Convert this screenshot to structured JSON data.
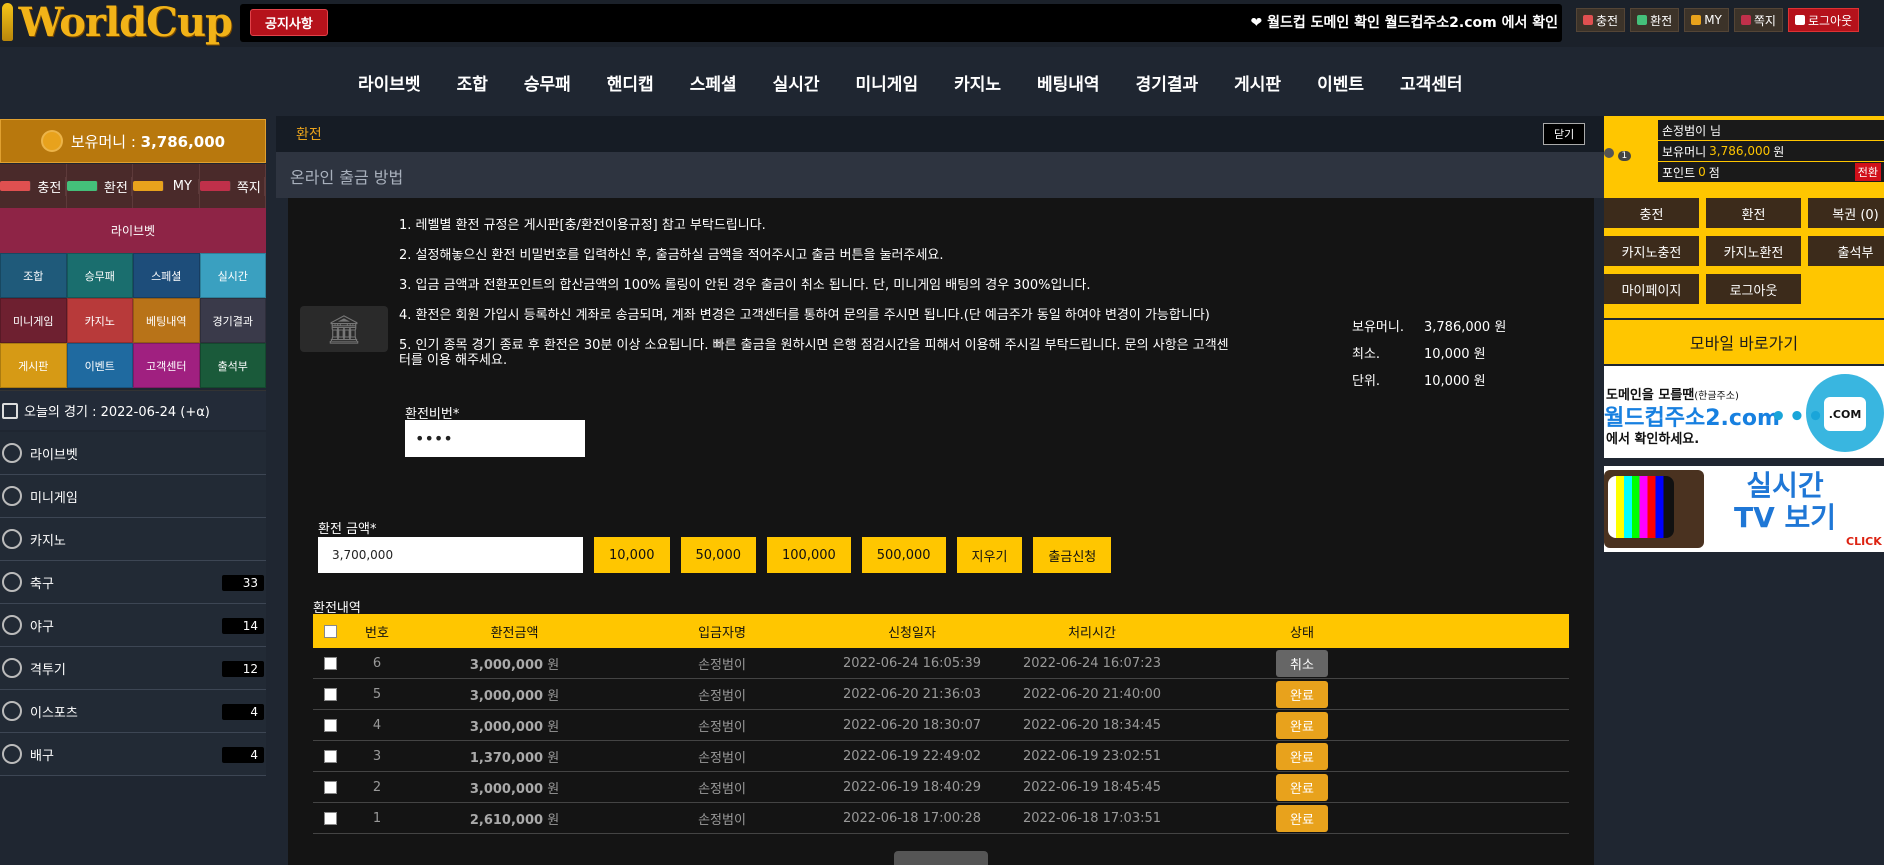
{
  "brand": {
    "logo_text": "WorldCup"
  },
  "topbar": {
    "notice_button": "공지사항",
    "notice_text": "❤ 월드컵 도메인 확인 월드컵주소2.com 에서 확인",
    "buttons": [
      {
        "label": "충전",
        "color": "#e05050"
      },
      {
        "label": "환전",
        "color": "#44c07a"
      },
      {
        "label": "MY",
        "color": "#e8a21c"
      },
      {
        "label": "쪽지",
        "color": "#c0304a"
      },
      {
        "label": "로그아웃",
        "color": "#ffffff"
      }
    ]
  },
  "nav": [
    "라이브벳",
    "조합",
    "승무패",
    "핸디캡",
    "스페셜",
    "실시간",
    "미니게임",
    "카지노",
    "베팅내역",
    "경기결과",
    "게시판",
    "이벤트",
    "고객센터"
  ],
  "sidebar": {
    "money_label": "보유머니 : ",
    "money_value": "3,786,000",
    "quick": [
      "충전",
      "환전",
      "MY",
      "쪽지"
    ],
    "live": "라이브벳",
    "grid": [
      {
        "label": "조합",
        "color": "#1f5a7a"
      },
      {
        "label": "승무패",
        "color": "#1a6e6e"
      },
      {
        "label": "스페셜",
        "color": "#1d4d7a"
      },
      {
        "label": "실시간",
        "color": "#3aa0c0"
      },
      {
        "label": "미니게임",
        "color": "#6e2030"
      },
      {
        "label": "카지노",
        "color": "#b83a3a"
      },
      {
        "label": "베팅내역",
        "color": "#b87318"
      },
      {
        "label": "경기결과",
        "color": "#3a3a4a"
      },
      {
        "label": "게시판",
        "color": "#d69a15"
      },
      {
        "label": "이벤트",
        "color": "#1f6aa0"
      },
      {
        "label": "고객센터",
        "color": "#a02080"
      },
      {
        "label": "출석부",
        "color": "#1a5a3a"
      }
    ],
    "today": "오늘의 경기 : 2022-06-24 (+α)",
    "list": [
      {
        "label": "라이브벳",
        "count": ""
      },
      {
        "label": "미니게임",
        "count": ""
      },
      {
        "label": "카지노",
        "count": ""
      },
      {
        "label": "축구",
        "count": "33"
      },
      {
        "label": "야구",
        "count": "14"
      },
      {
        "label": "격투기",
        "count": "12"
      },
      {
        "label": "이스포츠",
        "count": "4"
      },
      {
        "label": "배구",
        "count": "4"
      }
    ]
  },
  "main": {
    "title": "환전",
    "close": "닫기",
    "subtitle": "온라인 출금 방법",
    "rules": [
      "1. 레벨별 환전 규정은 게시판[충/환전이용규정] 참고 부탁드립니다.",
      "2. 설정해놓으신 환전 비밀번호를 입력하신 후, 출금하실 금액을 적어주시고 출금 버튼을 눌러주세요.",
      "3. 입금 금액과 전환포인트의 합산금액의 100% 롤링이 안된 경우 출금이 취소 됩니다. 단, 미니게임 배팅의 경우 300%입니다.",
      "4. 환전은 회원 가입시 등록하신 계좌로 송금되며, 계좌 변경은 고객센터를 통하여 문의를 주시면 됩니다.(단 예금주가 동일 하여야 변경이 가능합니다)",
      "5. 인기 종목 경기 종료 후 환전은 30분 이상 소요됩니다. 빠른 출금을 원하시면 은행 점검시간을 피해서 이용해 주시길 부탁드립니다. 문의 사항은 고객센터를 이용 해주세요."
    ],
    "info": [
      {
        "k": "보유머니.",
        "v": "3,786,000",
        "u": "원"
      },
      {
        "k": "최소.",
        "v": "10,000",
        "u": "원"
      },
      {
        "k": "단위.",
        "v": "10,000",
        "u": "원"
      }
    ],
    "pw_label": "환전비번*",
    "pw_value": "••••",
    "amount_label": "환전 금액*",
    "amount_value": "3,700,000",
    "amount_buttons": [
      "10,000",
      "50,000",
      "100,000",
      "500,000",
      "지우기",
      "출금신청"
    ],
    "history_label": "환전내역",
    "columns": [
      "번호",
      "환전금액",
      "입금자명",
      "신청일자",
      "처리시간",
      "상태"
    ],
    "rows": [
      {
        "no": "6",
        "amount": "3,000,000",
        "unit": "원",
        "name": "손정범이",
        "req": "2022-06-24 16:05:39",
        "done": "2022-06-24 16:07:23",
        "status": "취소",
        "kind": "cancel"
      },
      {
        "no": "5",
        "amount": "3,000,000",
        "unit": "원",
        "name": "손정범이",
        "req": "2022-06-20 21:36:03",
        "done": "2022-06-20 21:40:00",
        "status": "완료",
        "kind": "done"
      },
      {
        "no": "4",
        "amount": "3,000,000",
        "unit": "원",
        "name": "손정범이",
        "req": "2022-06-20 18:30:07",
        "done": "2022-06-20 18:34:45",
        "status": "완료",
        "kind": "done"
      },
      {
        "no": "3",
        "amount": "1,370,000",
        "unit": "원",
        "name": "손정범이",
        "req": "2022-06-19 22:49:02",
        "done": "2022-06-19 23:02:51",
        "status": "완료",
        "kind": "done"
      },
      {
        "no": "2",
        "amount": "3,000,000",
        "unit": "원",
        "name": "손정범이",
        "req": "2022-06-19 18:40:29",
        "done": "2022-06-19 18:45:45",
        "status": "완료",
        "kind": "done"
      },
      {
        "no": "1",
        "amount": "2,610,000",
        "unit": "원",
        "name": "손정범이",
        "req": "2022-06-18 17:00:28",
        "done": "2022-06-18 17:03:51",
        "status": "완료",
        "kind": "done"
      }
    ]
  },
  "right": {
    "level": "1",
    "user": {
      "name": "손정범이 님",
      "money_label": "보유머니",
      "money_value": "3,786,000",
      "money_unit": "원",
      "point_label": "포인트",
      "point_value": "0",
      "point_unit": "점",
      "convert": "전환"
    },
    "buttons": [
      "충전",
      "환전",
      "복권 (0)",
      "카지노충전",
      "카지노환전",
      "출석부",
      "마이페이지",
      "로그아웃"
    ],
    "mobile": "모바일 바로가기",
    "banner1": {
      "line1": "도메인을 모를땐",
      "line1_small": "(한글주소)",
      "line2": "월드컵주소2.com",
      "dots": "•••",
      "screen": ".COM",
      "line3": "에서 확인하세요."
    },
    "banner2": {
      "title": "실시간\nTV 보기",
      "click": "CLICK"
    }
  }
}
